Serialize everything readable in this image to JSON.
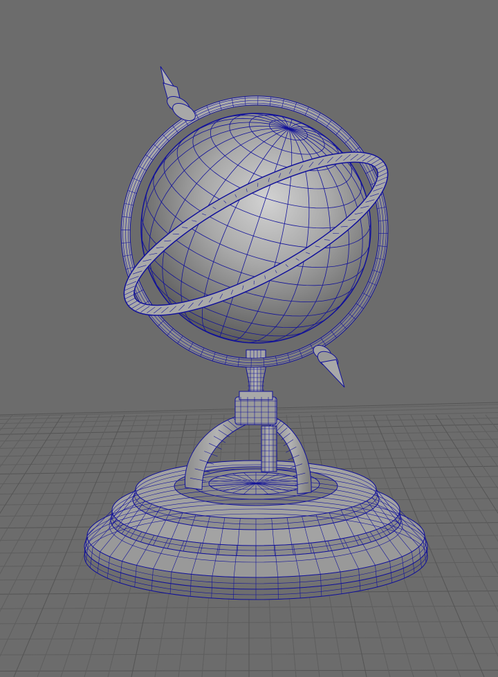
{
  "viewport": {
    "name": "perspective-viewport",
    "background_color": "#6c6c6c",
    "grid_color": "#5e5e5e",
    "grid_major_color": "#545454",
    "mesh": {
      "object": "globe",
      "display_mode": "smooth-shaded-with-wireframe",
      "shade_color": "#9a9a9a",
      "wire_color": "#11119a"
    }
  }
}
